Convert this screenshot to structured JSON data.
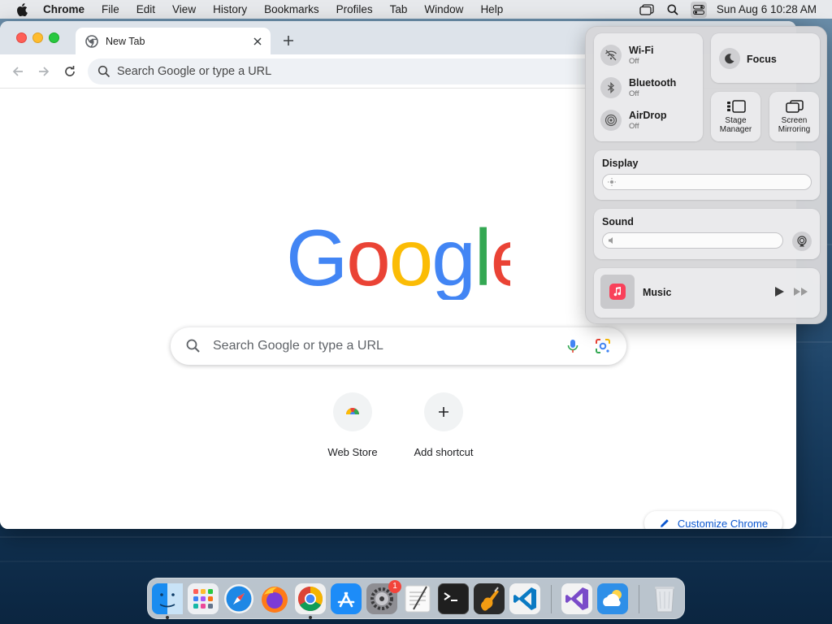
{
  "menubar": {
    "app_name": "Chrome",
    "items": [
      "File",
      "Edit",
      "View",
      "History",
      "Bookmarks",
      "Profiles",
      "Tab",
      "Window",
      "Help"
    ],
    "clock": "Sun Aug 6  10:28 AM",
    "status_icons": [
      "stage-manager-icon",
      "spotlight-search-icon",
      "control-center-icon"
    ]
  },
  "browser": {
    "tab_title": "New Tab",
    "omnibox_placeholder": "Search Google or type a URL",
    "search_placeholder": "Search Google or type a URL",
    "logo_text": "Google",
    "shortcuts": [
      {
        "label": "Web Store",
        "icon": "chrome-web-store-icon"
      },
      {
        "label": "Add shortcut",
        "icon": "plus-icon"
      }
    ],
    "customize_label": "Customize Chrome"
  },
  "control_center": {
    "network": [
      {
        "name": "Wi-Fi",
        "state": "Off",
        "icon": "wifi-off-icon"
      },
      {
        "name": "Bluetooth",
        "state": "Off",
        "icon": "bluetooth-icon"
      },
      {
        "name": "AirDrop",
        "state": "Off",
        "icon": "airdrop-icon"
      }
    ],
    "focus_label": "Focus",
    "stage_manager_label": [
      "Stage",
      "Manager"
    ],
    "screen_mirroring_label": [
      "Screen",
      "Mirroring"
    ],
    "display_label": "Display",
    "sound_label": "Sound",
    "music_label": "Music"
  },
  "dock": {
    "apps": [
      "Finder",
      "Launchpad",
      "Safari",
      "Firefox",
      "Google Chrome",
      "App Store",
      "System Settings",
      "TextEdit",
      "Terminal",
      "GarageBand",
      "Visual Studio Code",
      "Visual Studio",
      "Weather",
      "Trash"
    ],
    "system_settings_badge": "1"
  },
  "colors": {
    "accent_blue": "#0b57d0",
    "google_blue": "#4285F4",
    "google_red": "#EA4335",
    "google_yellow": "#FBBC05",
    "google_green": "#34A853"
  }
}
